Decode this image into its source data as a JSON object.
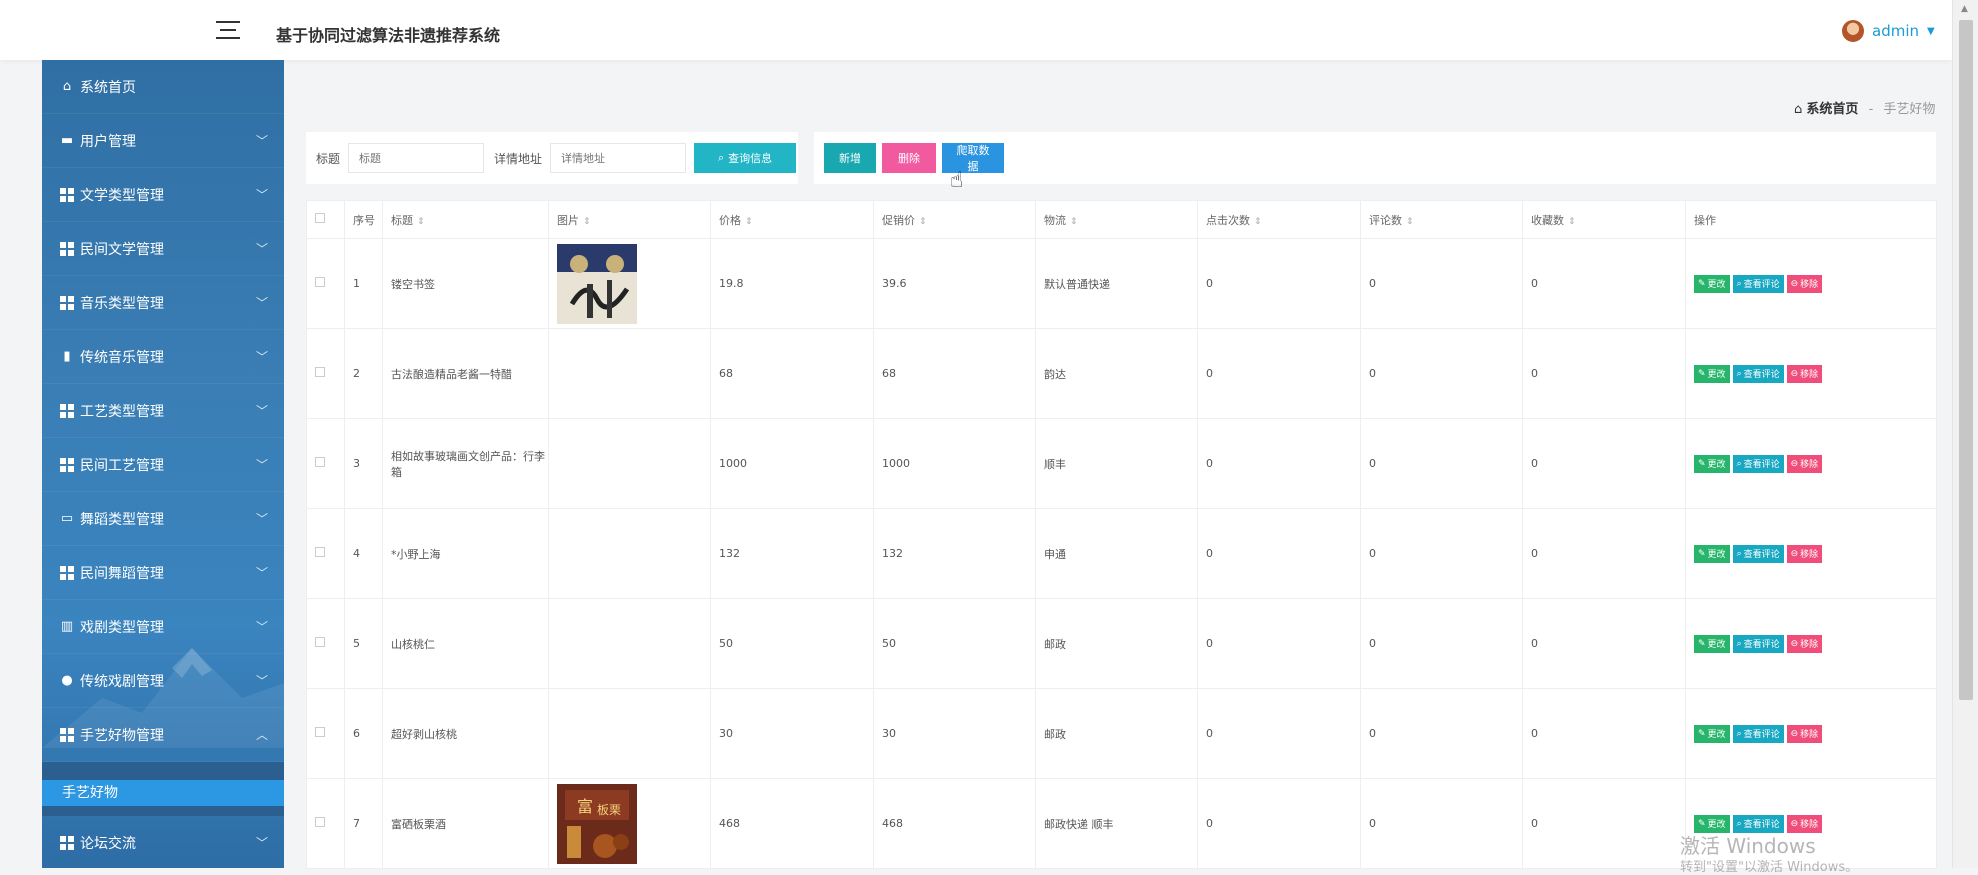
{
  "header": {
    "title": "基于协同过滤算法非遗推荐系统",
    "user": "admin"
  },
  "sidebar": {
    "items": [
      {
        "label": "系统首页",
        "icon": "home-icon"
      },
      {
        "label": "用户管理",
        "icon": "user-card-icon"
      },
      {
        "label": "文学类型管理",
        "icon": "grid-icon"
      },
      {
        "label": "民间文学管理",
        "icon": "grid-icon"
      },
      {
        "label": "音乐类型管理",
        "icon": "grid-icon"
      },
      {
        "label": "传统音乐管理",
        "icon": "clipboard-icon"
      },
      {
        "label": "工艺类型管理",
        "icon": "grid-icon"
      },
      {
        "label": "民间工艺管理",
        "icon": "grid-icon"
      },
      {
        "label": "舞蹈类型管理",
        "icon": "monitor-icon"
      },
      {
        "label": "民间舞蹈管理",
        "icon": "grid-icon"
      },
      {
        "label": "戏剧类型管理",
        "icon": "bar-chart-icon"
      },
      {
        "label": "传统戏剧管理",
        "icon": "bulb-icon"
      },
      {
        "label": "手艺好物管理",
        "icon": "grid-icon"
      }
    ],
    "active_sub": "手艺好物",
    "last_item": "论坛交流"
  },
  "breadcrumb": {
    "home": "系统首页",
    "separator": "-",
    "current": "手艺好物"
  },
  "search": {
    "title_label": "标题",
    "title_placeholder": "标题",
    "url_label": "详情地址",
    "url_placeholder": "详情地址",
    "search_button": "查询信息"
  },
  "actions": {
    "add": "新增",
    "delete": "删除",
    "crawl": "爬取数据"
  },
  "table": {
    "columns": [
      "序号",
      "标题",
      "图片",
      "价格",
      "促销价",
      "物流",
      "点击次数",
      "评论数",
      "收藏数",
      "操作"
    ],
    "rows": [
      {
        "no": "1",
        "title": "镂空书签",
        "image": "bookmark",
        "price": "19.8",
        "sale": "39.6",
        "logistics": "默认普通快递",
        "clicks": "0",
        "comments": "0",
        "favorites": "0"
      },
      {
        "no": "2",
        "title": "古法酿造精品老酱一特醋",
        "image": "",
        "price": "68",
        "sale": "68",
        "logistics": "韵达",
        "clicks": "0",
        "comments": "0",
        "favorites": "0"
      },
      {
        "no": "3",
        "title": "相如故事玻璃画文创产品：行李箱",
        "image": "",
        "price": "1000",
        "sale": "1000",
        "logistics": "顺丰",
        "clicks": "0",
        "comments": "0",
        "favorites": "0"
      },
      {
        "no": "4",
        "title": "*小野上海",
        "image": "",
        "price": "132",
        "sale": "132",
        "logistics": "申通",
        "clicks": "0",
        "comments": "0",
        "favorites": "0"
      },
      {
        "no": "5",
        "title": "山核桃仁",
        "image": "",
        "price": "50",
        "sale": "50",
        "logistics": "邮政",
        "clicks": "0",
        "comments": "0",
        "favorites": "0"
      },
      {
        "no": "6",
        "title": "超好剥山核桃",
        "image": "",
        "price": "30",
        "sale": "30",
        "logistics": "邮政",
        "clicks": "0",
        "comments": "0",
        "favorites": "0"
      },
      {
        "no": "7",
        "title": "富硒板栗酒",
        "image": "chestnut-wine",
        "price": "468",
        "sale": "468",
        "logistics": "邮政快递 顺丰",
        "clicks": "0",
        "comments": "0",
        "favorites": "0"
      }
    ],
    "op_labels": {
      "edit": "更改",
      "view": "查看评论",
      "remove": "移除"
    }
  },
  "watermark": {
    "line1": "激活 Windows",
    "line2": "转到\"设置\"以激活 Windows。"
  }
}
